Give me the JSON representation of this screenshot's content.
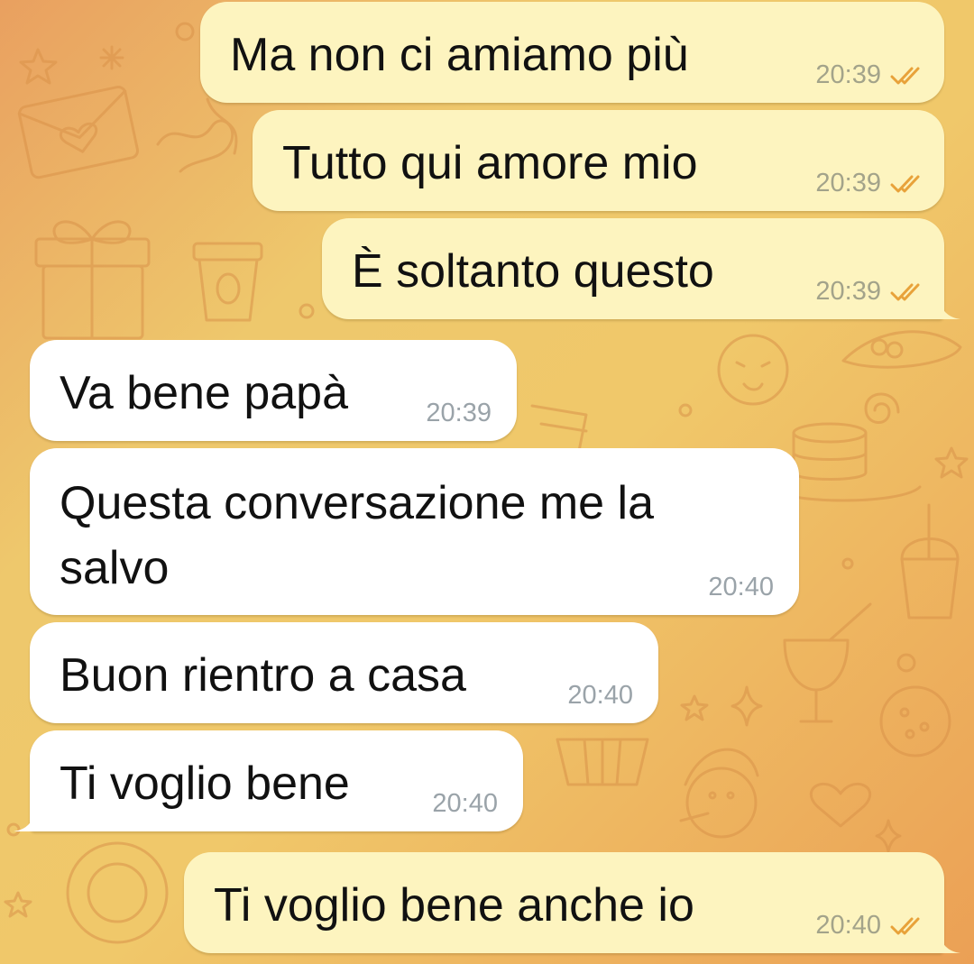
{
  "colors": {
    "outgoing_bubble": "#fdf4bf",
    "incoming_bubble": "#ffffff",
    "read_check": "#e8a23a",
    "time_outgoing": "#a3a38a",
    "time_incoming": "#9aa3a9"
  },
  "icons": {
    "read_status": "double-check-icon"
  },
  "messages": [
    {
      "direction": "out",
      "text": "Ma non ci amiamo più",
      "time": "20:39",
      "status": "read"
    },
    {
      "direction": "out",
      "text": "Tutto qui amore mio",
      "time": "20:39",
      "status": "read"
    },
    {
      "direction": "out",
      "text": "È soltanto questo",
      "time": "20:39",
      "status": "read"
    },
    {
      "direction": "in",
      "text": "Va bene papà",
      "time": "20:39"
    },
    {
      "direction": "in",
      "text": "Questa conversazione me la salvo",
      "time": "20:40"
    },
    {
      "direction": "in",
      "text": "Buon rientro a casa",
      "time": "20:40"
    },
    {
      "direction": "in",
      "text": "Ti voglio bene",
      "time": "20:40"
    },
    {
      "direction": "out",
      "text": "Ti voglio bene anche io",
      "time": "20:40",
      "status": "read"
    }
  ]
}
